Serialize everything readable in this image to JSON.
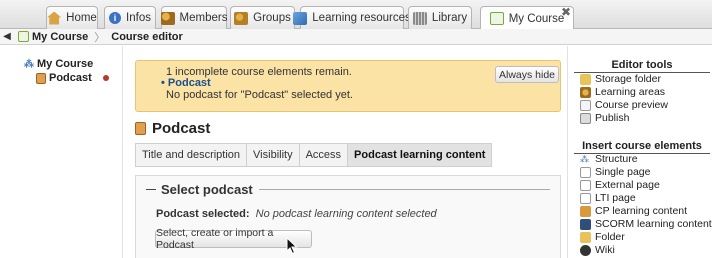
{
  "tabs": [
    {
      "label": "Home",
      "icon": "home-icon",
      "color": "#d9a441"
    },
    {
      "label": "Infos",
      "icon": "info-icon",
      "color": "#3b73c4"
    },
    {
      "label": "Members",
      "icon": "members-icon",
      "color": "#c98a2b"
    },
    {
      "label": "Groups",
      "icon": "groups-icon",
      "color": "#c98a2b"
    },
    {
      "label": "Learning resources",
      "icon": "learning-resources-icon",
      "color": "#3a7fc1"
    },
    {
      "label": "Library",
      "icon": "library-icon",
      "color": "#8a8a8a"
    },
    {
      "label": "My Course",
      "icon": "course-icon",
      "color": "#7aa83c",
      "active": true,
      "closable": true
    }
  ],
  "breadcrumb": {
    "course": "My Course",
    "current": "Course editor"
  },
  "tree": {
    "root": "My Course",
    "node": "Podcast"
  },
  "warning": {
    "line1": "1 incomplete course elements remain.",
    "item": "Podcast",
    "line3": "No podcast for \"Podcast\" selected yet.",
    "hide_button": "Always hide"
  },
  "element_title": "Podcast",
  "subtabs": [
    "Title and description",
    "Visibility",
    "Access",
    "Podcast learning content"
  ],
  "select_panel": {
    "legend": "Select podcast",
    "selected_label": "Podcast selected:",
    "selected_value": "No podcast learning content selected",
    "create_button": "Select, create or import a Podcast"
  },
  "editor_tools": {
    "title": "Editor tools",
    "items": [
      {
        "label": "Storage folder",
        "icon": "folder-icon"
      },
      {
        "label": "Learning areas",
        "icon": "learning-areas-icon"
      },
      {
        "label": "Course preview",
        "icon": "preview-icon"
      },
      {
        "label": "Publish",
        "icon": "publish-icon"
      }
    ]
  },
  "insert_elements": {
    "title": "Insert course elements",
    "items": [
      {
        "label": "Structure",
        "icon": "structure-icon"
      },
      {
        "label": "Single page",
        "icon": "single-page-icon"
      },
      {
        "label": "External page",
        "icon": "external-page-icon"
      },
      {
        "label": "LTI page",
        "icon": "lti-page-icon"
      },
      {
        "label": "CP learning content",
        "icon": "cp-learning-content-icon"
      },
      {
        "label": "SCORM learning content",
        "icon": "scorm-icon"
      },
      {
        "label": "Folder",
        "icon": "folder-icon"
      },
      {
        "label": "Wiki",
        "icon": "wiki-icon"
      }
    ]
  },
  "colors": {
    "warning_bg": "#fbe3a6",
    "warning_border": "#e6c474",
    "status_dot": "#b53b2c",
    "link": "#1d4e8c"
  }
}
